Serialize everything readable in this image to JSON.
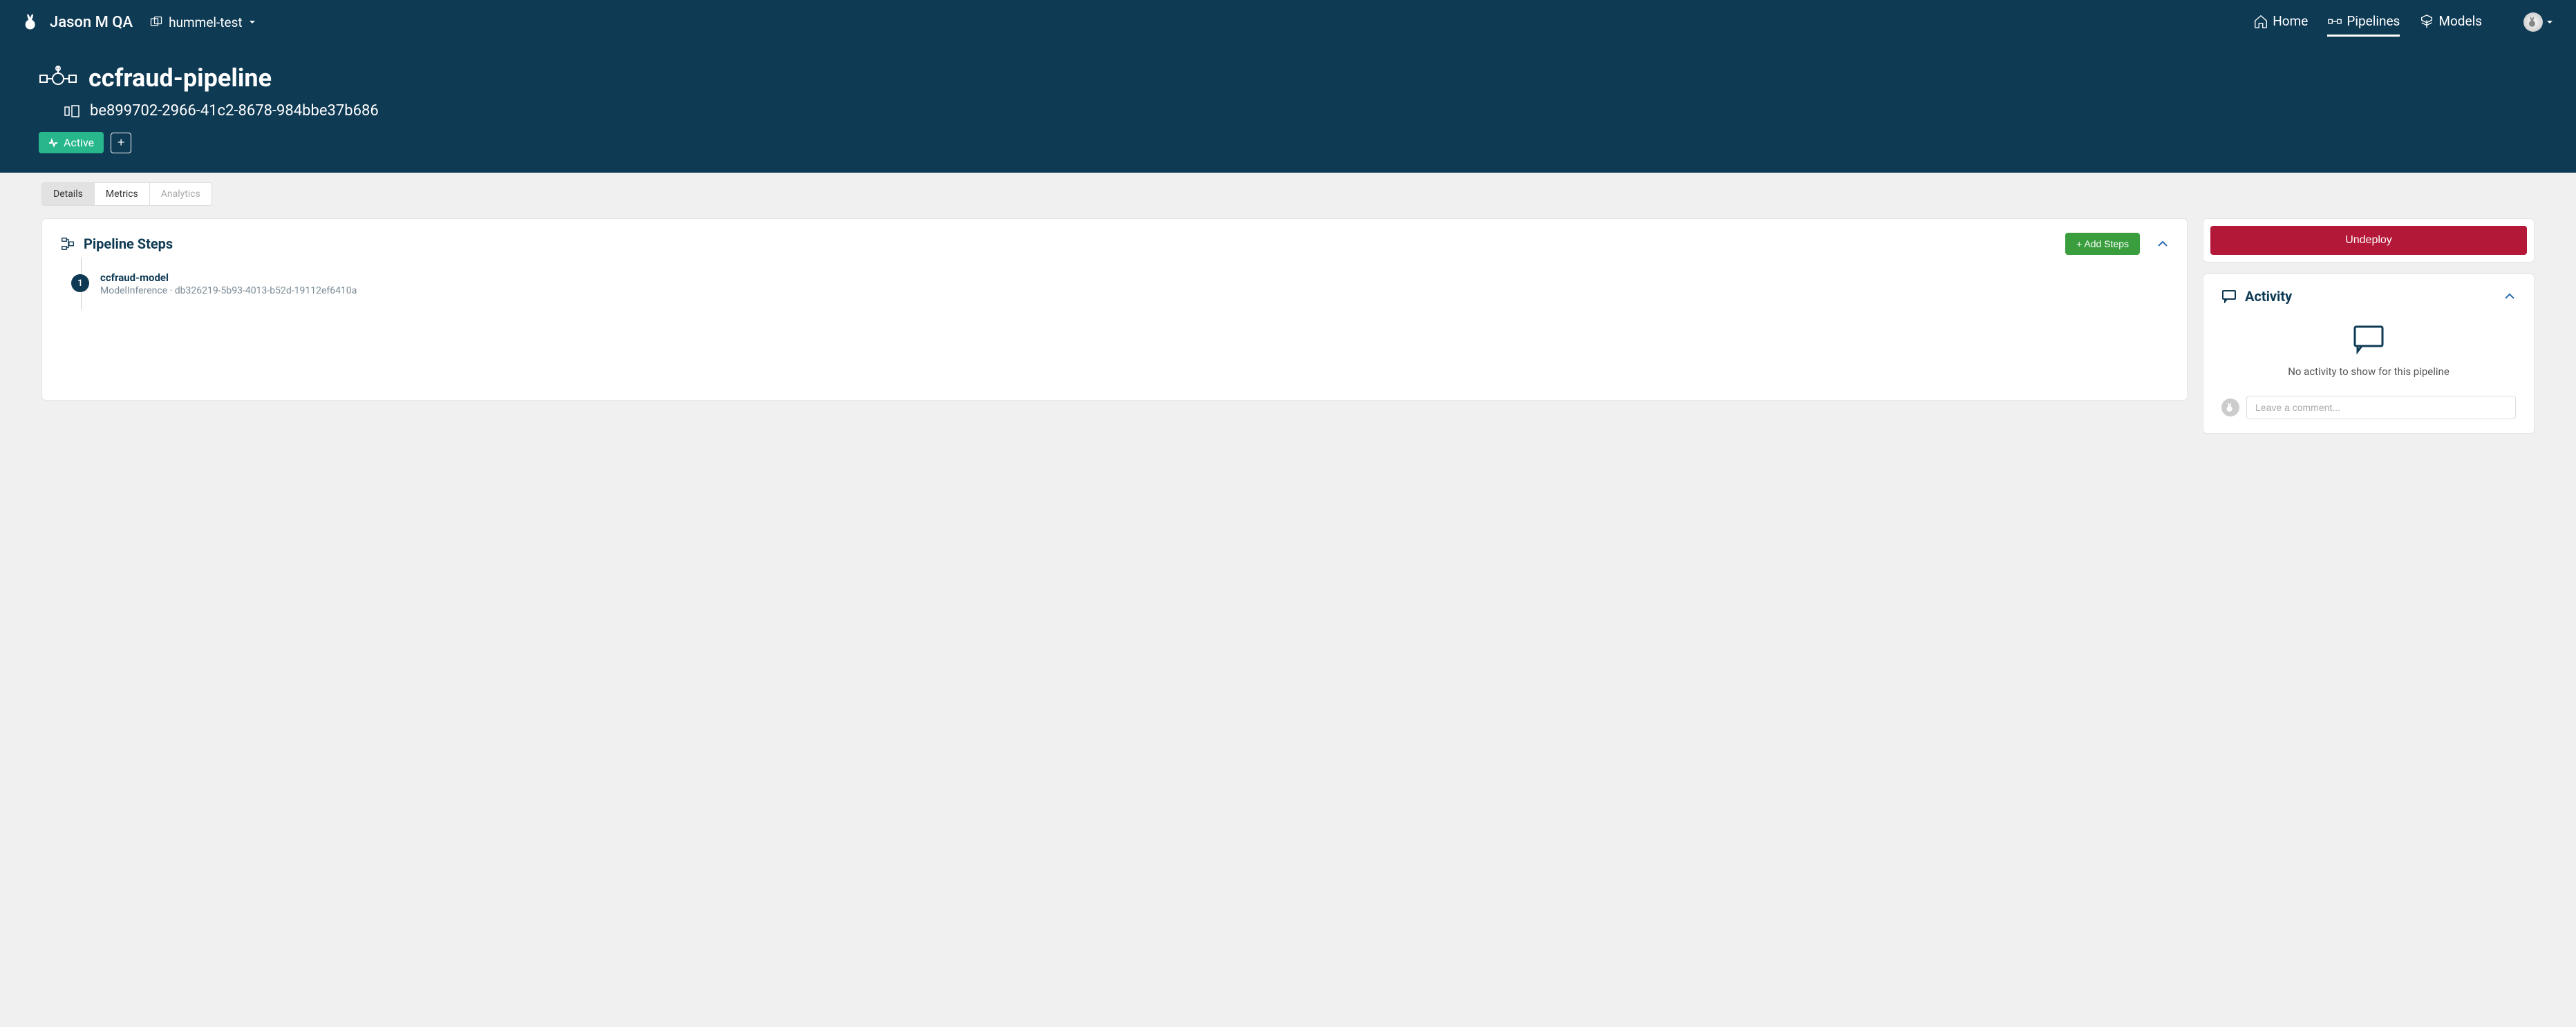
{
  "header": {
    "org_name": "Jason M QA",
    "workspace": "hummel-test",
    "nav": {
      "home": "Home",
      "pipelines": "Pipelines",
      "models": "Models"
    },
    "pipeline_title": "ccfraud-pipeline",
    "pipeline_id": "be899702-2966-41c2-8678-984bbe37b686",
    "status_label": "Active"
  },
  "tabs": {
    "details": "Details",
    "metrics": "Metrics",
    "analytics": "Analytics"
  },
  "steps_card": {
    "title": "Pipeline Steps",
    "add_button": "+ Add Steps",
    "steps": [
      {
        "num": "1",
        "name": "ccfraud-model",
        "meta": "ModelInference · db326219-5b93-4013-b52d-19112ef6410a"
      }
    ]
  },
  "sidebar": {
    "undeploy_label": "Undeploy",
    "activity_title": "Activity",
    "activity_empty": "No activity to show for this pipeline",
    "comment_placeholder": "Leave a comment..."
  }
}
